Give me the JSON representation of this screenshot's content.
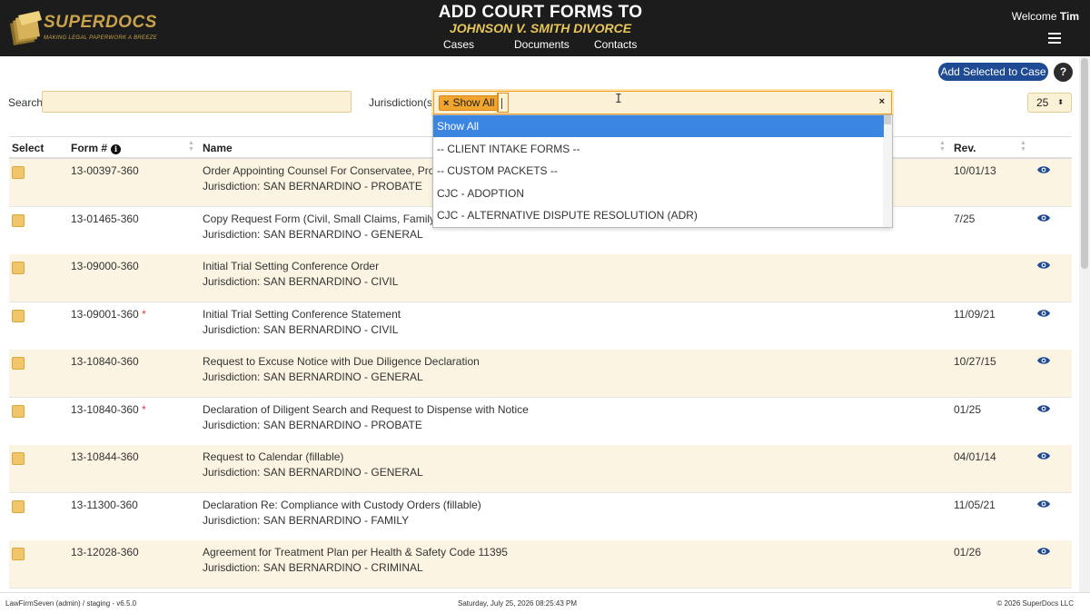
{
  "header": {
    "logo_title": "SUPERDOCS",
    "logo_tagline": "MAKING LEGAL PAPERWORK A BREEZE",
    "page_title": "ADD COURT FORMS TO",
    "case_name": "JOHNSON V. SMITH DIVORCE",
    "nav": [
      "Cases",
      "Documents",
      "Contacts"
    ],
    "welcome_prefix": "Welcome",
    "user_name": "Tim"
  },
  "toolbar": {
    "add_selected_label": "Add Selected to Case",
    "help_label": "?",
    "search_label": "Search",
    "search_value": "",
    "jurisdiction_label": "Jurisdiction(s)",
    "jurisdiction_tag": "Show All",
    "tag_remove": "×",
    "clear_label": "×",
    "per_page": "25",
    "per_page_arrow": "⬍"
  },
  "table": {
    "headers": {
      "select": "Select",
      "form_no": "Form #",
      "name": "Name",
      "rev": "Rev."
    },
    "rows": [
      {
        "form_no": "13-00397-360",
        "star": "",
        "name": "Order Appointing Counsel For Conservatee, Probate",
        "jurisdiction": "Jurisdiction: SAN BERNARDINO - PROBATE",
        "rev": "10/01/13"
      },
      {
        "form_no": "13-01465-360",
        "star": "",
        "name": "Copy Request Form (Civil, Small Claims, Family Law, ",
        "jurisdiction": "Jurisdiction: SAN BERNARDINO - GENERAL",
        "rev": "7/25"
      },
      {
        "form_no": "13-09000-360",
        "star": "",
        "name": "Initial Trial Setting Conference Order",
        "jurisdiction": "Jurisdiction: SAN BERNARDINO - CIVIL",
        "rev": ""
      },
      {
        "form_no": "13-09001-360",
        "star": "*",
        "name": "Initial Trial Setting Conference Statement",
        "jurisdiction": "Jurisdiction: SAN BERNARDINO - CIVIL",
        "rev": "11/09/21"
      },
      {
        "form_no": "13-10840-360",
        "star": "",
        "name": "Request to Excuse Notice with Due Diligence Declaration",
        "jurisdiction": "Jurisdiction: SAN BERNARDINO - GENERAL",
        "rev": "10/27/15"
      },
      {
        "form_no": "13-10840-360",
        "star": "*",
        "name": "Declaration of Diligent Search and Request to Dispense with Notice",
        "jurisdiction": "Jurisdiction: SAN BERNARDINO - PROBATE",
        "rev": "01/25"
      },
      {
        "form_no": "13-10844-360",
        "star": "",
        "name": "Request to Calendar (fillable)",
        "jurisdiction": "Jurisdiction: SAN BERNARDINO - GENERAL",
        "rev": "04/01/14"
      },
      {
        "form_no": "13-11300-360",
        "star": "",
        "name": "Declaration Re: Compliance with Custody Orders (fillable)",
        "jurisdiction": "Jurisdiction: SAN BERNARDINO - FAMILY",
        "rev": "11/05/21"
      },
      {
        "form_no": "13-12028-360",
        "star": "",
        "name": "Agreement for Treatment Plan per Health & Safety Code 11395",
        "jurisdiction": "Jurisdiction: SAN BERNARDINO - CRIMINAL",
        "rev": "01/26"
      }
    ]
  },
  "dropdown": {
    "options": [
      "Show All",
      "-- CLIENT INTAKE FORMS --",
      "-- CUSTOM PACKETS --",
      "CJC - ADOPTION",
      "CJC - ALTERNATIVE DISPUTE RESOLUTION (ADR)"
    ],
    "selected_index": 0
  },
  "footer": {
    "left": "LawFirmSeven (admin) / staging - v6.5.0",
    "center": "Saturday, July 25, 2026 08:25:43 PM",
    "right": "© 2026 SuperDocs LLC"
  },
  "colors": {
    "header_bg": "#1c1c1c",
    "brand_gold": "#c9a24b",
    "case_title": "#e8c65a",
    "primary_button": "#1f4a94",
    "selected_option": "#3a86e0",
    "row_alt": "#fbf4e2",
    "checkbox": "#f1c66a",
    "tag": "#f2a52e",
    "required_star": "#e03b3b"
  }
}
